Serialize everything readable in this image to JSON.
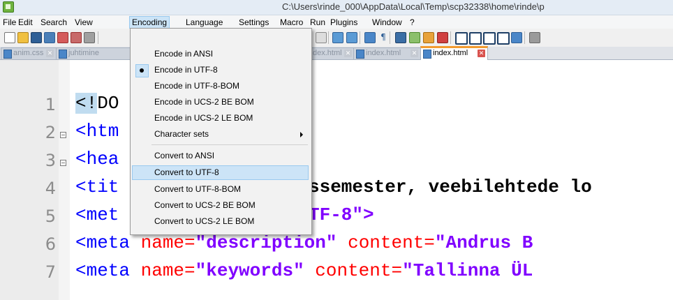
{
  "window": {
    "title": "C:\\Users\\rinde_000\\AppData\\Local\\Temp\\scp32338\\home\\rinde\\p"
  },
  "menubar": {
    "items": [
      "File",
      "Edit",
      "Search",
      "View",
      "Encoding",
      "Language",
      "Settings",
      "Macro",
      "Run",
      "Plugins",
      "Window",
      "?"
    ],
    "active": "Encoding"
  },
  "tabs": [
    {
      "label": "anim.css",
      "active": false
    },
    {
      "label": "juhtimine",
      "active": false
    },
    {
      "label": "dex.html",
      "active": false
    },
    {
      "label": "index.html",
      "active": false
    },
    {
      "label": "index.html",
      "active": true
    }
  ],
  "encoding_menu": {
    "items": [
      {
        "label": "Encode in ANSI",
        "checked": false
      },
      {
        "label": "Encode in UTF-8",
        "checked": true
      },
      {
        "label": "Encode in UTF-8-BOM",
        "checked": false
      },
      {
        "label": "Encode in UCS-2 BE BOM",
        "checked": false
      },
      {
        "label": "Encode in UCS-2 LE BOM",
        "checked": false
      },
      {
        "label": "Character sets",
        "submenu": true
      },
      {
        "label": "Convert to ANSI",
        "checked": false
      },
      {
        "label": "Convert to UTF-8",
        "highlighted": true
      },
      {
        "label": "Convert to UTF-8-BOM",
        "checked": false
      },
      {
        "label": "Convert to UCS-2 BE BOM",
        "checked": false
      },
      {
        "label": "Convert to UCS-2 LE BOM",
        "checked": false
      }
    ]
  },
  "editor": {
    "line_numbers": [
      "1",
      "2",
      "3",
      "4",
      "5",
      "6",
      "7"
    ],
    "lines": [
      [
        "<!",
        "DO"
      ],
      [
        "<htm"
      ],
      [
        "<hea"
      ],
      [
        "<tit",
        "ssemester, veebilehtede lo"
      ],
      [
        "<met",
        "TF-8\">"
      ],
      [
        "<meta",
        " name=",
        "\"description\"",
        " content=",
        "\"Andrus B"
      ],
      [
        "<meta",
        " name=",
        "\"keywords\"",
        " content=",
        "\"Tallinna ÜL"
      ]
    ]
  },
  "colors": {
    "tag": "#0000ff",
    "attribute": "#ff0000",
    "string": "#8000ff",
    "menu_highlight": "#cce4f7",
    "active_tab_accent": "#f39b2f"
  }
}
